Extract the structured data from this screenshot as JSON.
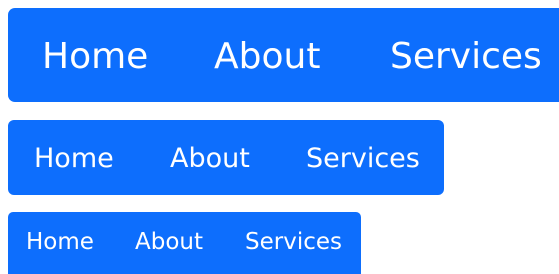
{
  "colors": {
    "navbar_background": "#0d6efd",
    "link_text": "#ffffff",
    "page_background": "#ffffff"
  },
  "navbars": {
    "large": {
      "links": [
        "Home",
        "About",
        "Services"
      ]
    },
    "medium": {
      "links": [
        "Home",
        "About",
        "Services"
      ]
    },
    "small": {
      "links": [
        "Home",
        "About",
        "Services"
      ]
    }
  }
}
